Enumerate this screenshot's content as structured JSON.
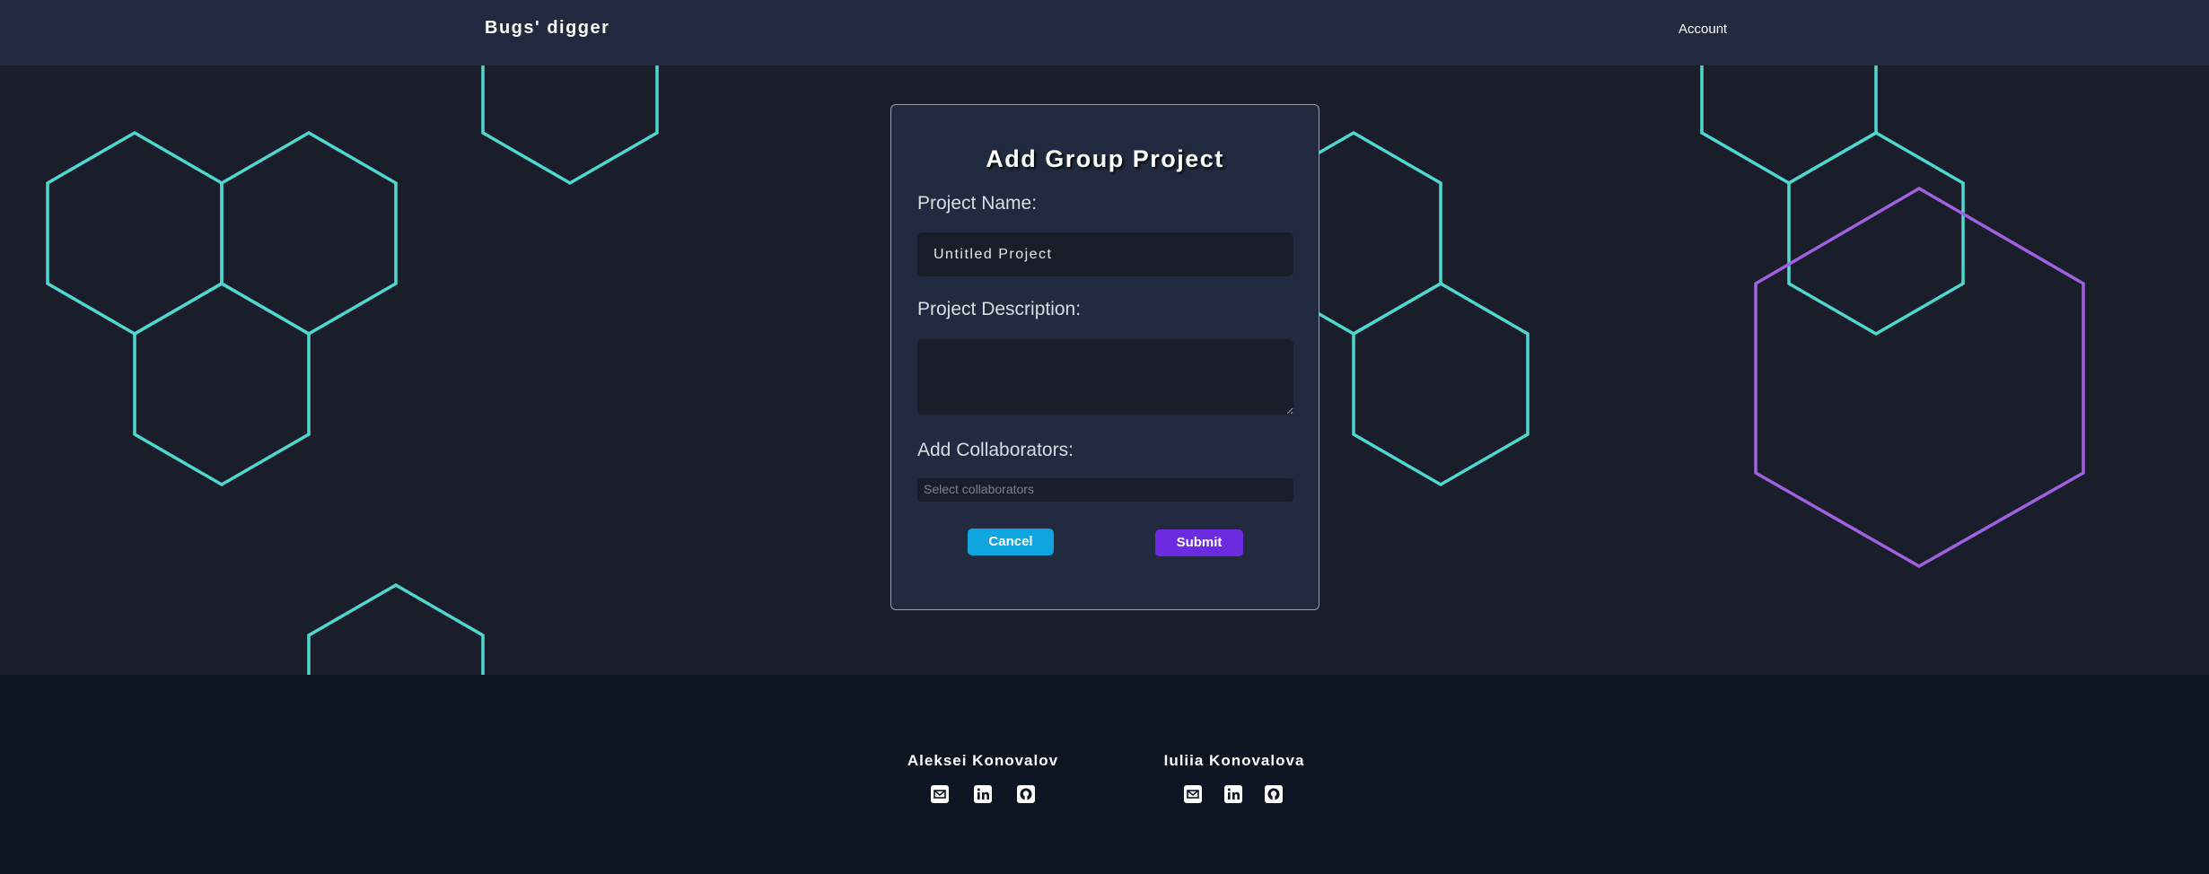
{
  "navbar": {
    "brand": "Bugs' digger",
    "account": "Account"
  },
  "modal": {
    "title": "Add Group Project",
    "project_name_label": "Project Name:",
    "project_name_value": "Untitled Project",
    "project_description_label": "Project Description:",
    "project_description_value": "",
    "collaborators_label": "Add Collaborators:",
    "collaborators_placeholder": "Select collaborators",
    "cancel_label": "Cancel",
    "submit_label": "Submit"
  },
  "footer": {
    "authors": [
      {
        "name": "Aleksei Konovalov",
        "icons": [
          "email-icon",
          "linkedin-icon",
          "github-icon"
        ]
      },
      {
        "name": "Iuliia Konovalova",
        "icons": [
          "email-icon",
          "linkedin-icon",
          "github-icon"
        ]
      }
    ]
  },
  "colors": {
    "background": "#1a1e2a",
    "navbar": "#212a3e",
    "footer": "#0d1424",
    "hexagon_teal": "#4fd8d0",
    "hexagon_purple": "#a060e0",
    "cancel_button": "#0ea5e0",
    "submit_button": "#6c2be0"
  }
}
